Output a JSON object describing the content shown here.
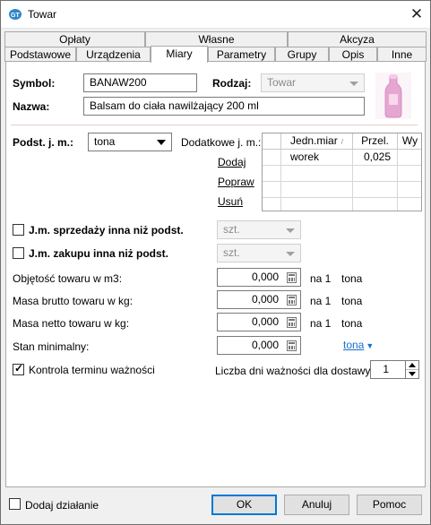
{
  "window": {
    "title": "Towar",
    "close_glyph": "✕"
  },
  "tabs_row1": [
    "Opłaty",
    "Własne",
    "Akcyza"
  ],
  "tabs_row2": [
    "Podstawowe",
    "Urządzenia",
    "Miary",
    "Parametry",
    "Grupy",
    "Opis",
    "Inne"
  ],
  "active_tab": "Miary",
  "form": {
    "symbol_label": "Symbol:",
    "symbol_value": "BANAW200",
    "rodzaj_label": "Rodzaj:",
    "rodzaj_value": "Towar",
    "nazwa_label": "Nazwa:",
    "nazwa_value": "Balsam do ciała nawilżający 200 ml",
    "podst_label": "Podst. j. m.:",
    "podst_value": "tona",
    "dodatkowe_label": "Dodatkowe j. m.:",
    "dodaj_link": "Dodaj",
    "popraw_link": "Popraw",
    "usun_link": "Usuń"
  },
  "units_table": {
    "headers": [
      "Jedn.miar",
      "Przel.",
      "Wy"
    ],
    "rows": [
      {
        "unit": "worek",
        "factor": "0,025",
        "wy": ""
      }
    ]
  },
  "sale_unit": {
    "label": "J.m. sprzedaży inna niż podst.",
    "checked": false,
    "value": "szt."
  },
  "purchase_unit": {
    "label": "J.m. zakupu inna niż podst.",
    "checked": false,
    "value": "szt."
  },
  "measures": [
    {
      "label": "Objętość towaru w m3:",
      "value": "0,000",
      "per": "na 1",
      "unit": "tona"
    },
    {
      "label": "Masa brutto towaru w kg:",
      "value": "0,000",
      "per": "na 1",
      "unit": "tona"
    },
    {
      "label": "Masa netto towaru w kg:",
      "value": "0,000",
      "per": "na 1",
      "unit": "tona"
    },
    {
      "label": "Stan minimalny:",
      "value": "0,000",
      "per": "",
      "unit": "tona"
    }
  ],
  "expiry": {
    "label": "Kontrola terminu ważności",
    "checked": true,
    "days_label": "Liczba dni ważności dla dostawy:",
    "days_value": "1"
  },
  "footer": {
    "add_action_label": "Dodaj działanie",
    "ok_label": "OK",
    "cancel_label": "Anuluj",
    "help_label": "Pomoc"
  },
  "colors": {
    "accent": "#0078d7",
    "link": "#1a6fd0",
    "product_pink": "#e6a6d2"
  },
  "icons": {
    "app": "app-icon",
    "close": "close-icon",
    "product": "product-bottle-image"
  }
}
